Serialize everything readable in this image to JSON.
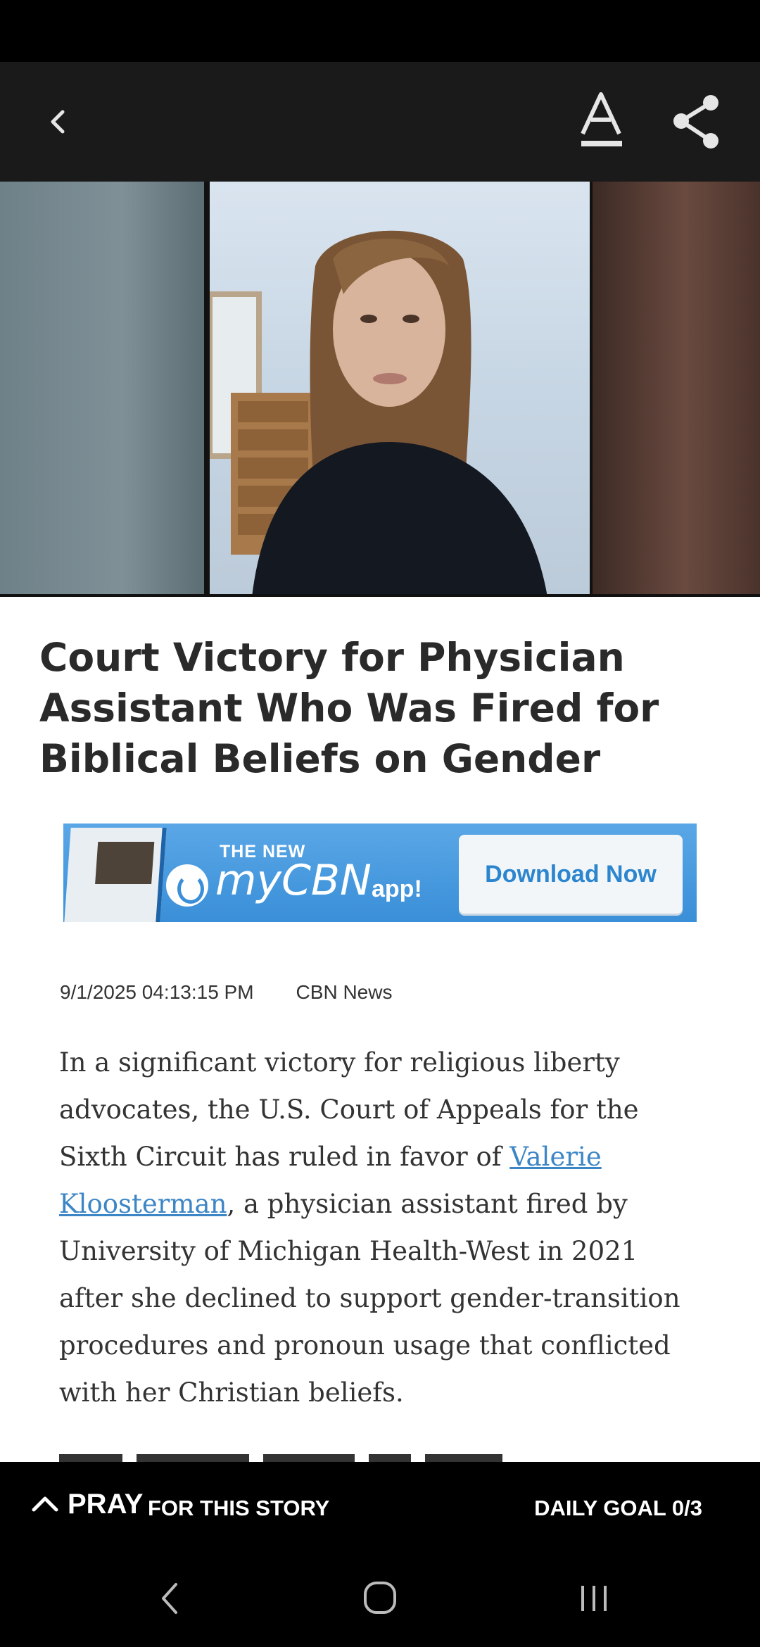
{
  "app_bar": {
    "icons": [
      "chevron-left-icon",
      "font-size-icon",
      "share-icon"
    ]
  },
  "article": {
    "title": "Court Victory for Physician Assistant Who Was Fired for Biblical Beliefs on Gender",
    "date": "9/1/2025 04:13:15 PM",
    "source": "CBN News",
    "body_pre": "In a significant victory for religious liberty advocates, the U.S. Court of Appeals for the Sixth Circuit has ruled in favor of ",
    "body_link": "Valerie Kloosterman",
    "body_post": ", a physician assistant fired by University of Michigan Health-West in 2021 after she declined to support gender-transition procedures and pronoun usage that conflicted with her Christian beliefs."
  },
  "banner": {
    "the_new": "THE NEW",
    "brand": "myCBN",
    "app": "app!",
    "download": "Download Now"
  },
  "pray_bar": {
    "pray": "PRAY",
    "for_story": "FOR THIS STORY",
    "daily_goal": "DAILY GOAL 0/3"
  },
  "colors": {
    "link": "#3d86c6",
    "banner": "#3a8fd8"
  }
}
